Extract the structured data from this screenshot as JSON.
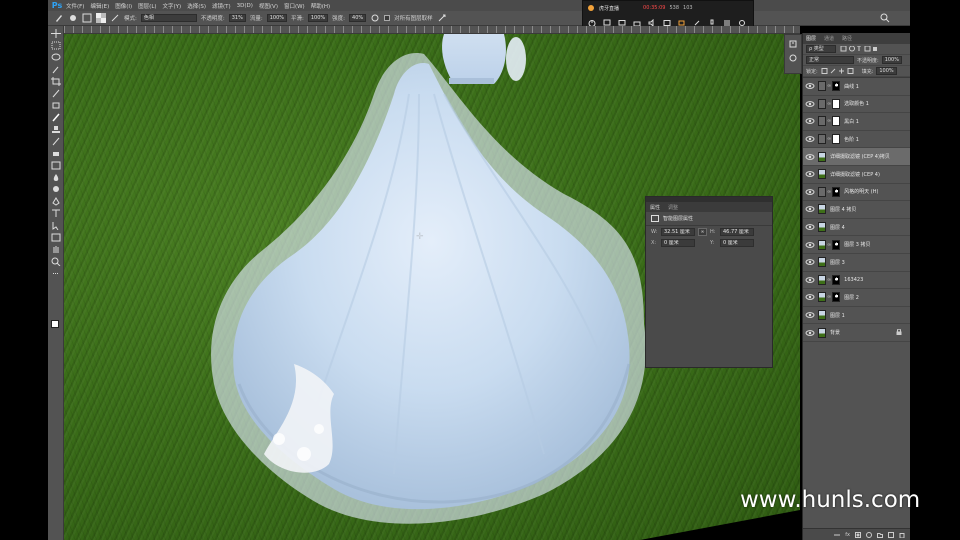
{
  "app": {
    "logo": "Ps",
    "menu": [
      "文件(F)",
      "编辑(E)",
      "图像(I)",
      "图层(L)",
      "文字(Y)",
      "选择(S)",
      "滤镜(T)",
      "3D(D)",
      "视图(V)",
      "窗口(W)",
      "帮助(H)"
    ]
  },
  "options": {
    "mode_label": "模式:",
    "mode_value": "色相",
    "opacity_label": "不透明度:",
    "opacity_value": "31%",
    "flow_label": "流量:",
    "flow_value": "100%",
    "smooth_label": "平滑:",
    "smooth_value": "100%",
    "strength_label": "强度:",
    "strength_value": "40%",
    "sample_all_label": "对所有图层取样"
  },
  "recorder": {
    "title": "虎牙直播",
    "time": "00:35:09",
    "stat1": "538",
    "stat2": "103"
  },
  "properties": {
    "tab_active": "属性",
    "tab_inactive": "调整",
    "header": "智能图层属性",
    "w_label": "W:",
    "w_value": "32.51 厘米",
    "h_label": "H:",
    "h_value": "46.77 厘米",
    "x_label": "X:",
    "x_value": "0 厘米",
    "y_label": "Y:",
    "y_value": "0 厘米"
  },
  "layers_panel": {
    "tabs": [
      "图层",
      "通道",
      "路径"
    ],
    "kind_label": "ρ 类型",
    "blend_mode": "正常",
    "opacity_label": "不透明度:",
    "opacity_value": "100%",
    "lock_label": "锁定:",
    "fill_label": "填充:",
    "fill_value": "100%",
    "layers": [
      {
        "name": "曲线 1"
      },
      {
        "name": "选取颜色 1"
      },
      {
        "name": "黑白 1"
      },
      {
        "name": "色阶 1"
      },
      {
        "name": "详细摄取滤镜 (CEP 4)拷贝"
      },
      {
        "name": "详细摄取滤镜 (CEP 4)"
      },
      {
        "name": "风格的明天 (H)"
      },
      {
        "name": "图层 4 拷贝"
      },
      {
        "name": "图层 4"
      },
      {
        "name": "图层 3 拷贝"
      },
      {
        "name": "图层 3"
      },
      {
        "name": "163423"
      },
      {
        "name": "图层 2"
      },
      {
        "name": "图层 1"
      },
      {
        "name": "背景"
      }
    ],
    "bottom_icons": [
      "fx"
    ]
  },
  "watermark": "www.hunls.com"
}
